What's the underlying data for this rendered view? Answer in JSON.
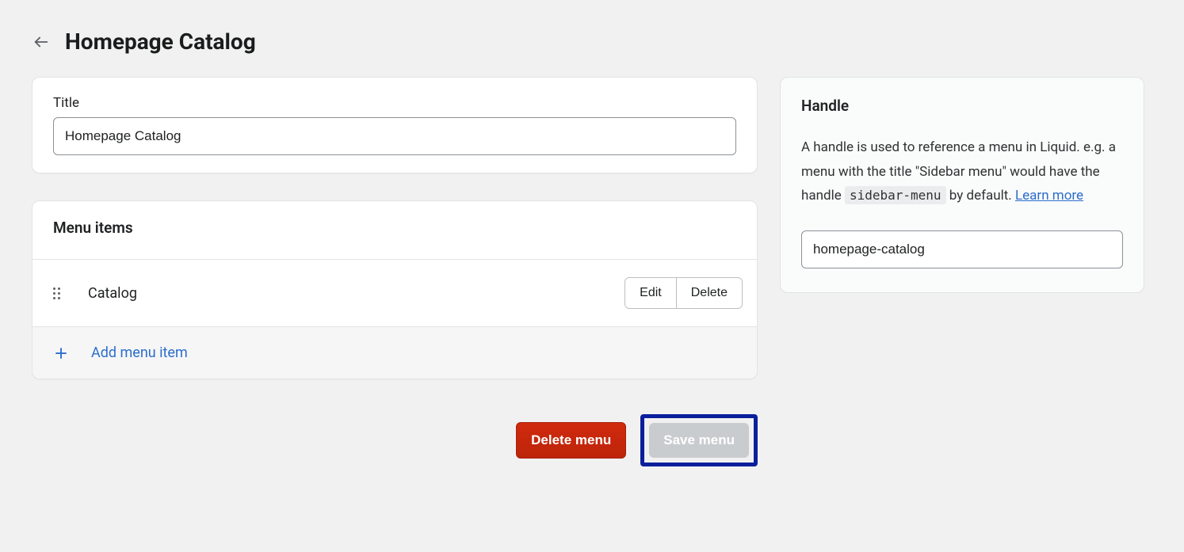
{
  "header": {
    "title": "Homepage Catalog"
  },
  "title_card": {
    "label": "Title",
    "value": "Homepage Catalog"
  },
  "menu_items": {
    "header": "Menu items",
    "items": [
      {
        "label": "Catalog",
        "edit": "Edit",
        "delete": "Delete"
      }
    ],
    "add_label": "Add menu item"
  },
  "handle": {
    "title": "Handle",
    "desc_pre": "A handle is used to reference a menu in Liquid. e.g. a menu with the title \"Sidebar menu\" would have the handle ",
    "code": "sidebar-menu",
    "desc_post": " by default. ",
    "learn_more": "Learn more",
    "value": "homepage-catalog"
  },
  "actions": {
    "delete": "Delete menu",
    "save": "Save menu"
  }
}
